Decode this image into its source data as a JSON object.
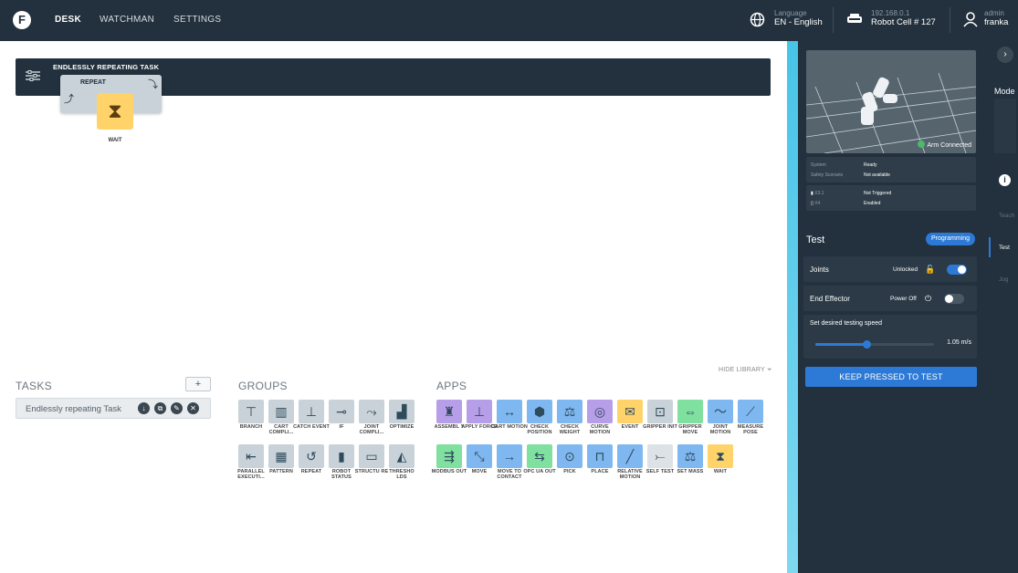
{
  "topbar": {
    "nav": [
      "DESK",
      "WATCHMAN",
      "SETTINGS"
    ],
    "language_label": "Language",
    "language_value": "EN - English",
    "ip": "192.168.0.1",
    "robot_name": "Robot Cell # 127",
    "user_role": "admin",
    "user_name": "franka"
  },
  "task": {
    "title": "ENDLESSLY REPEATING TASK",
    "repeat_label": "REPEAT",
    "wait_label": "WAIT"
  },
  "library": {
    "hide_label": "HIDE LIBRARY",
    "tasks_header": "TASKS",
    "add_label": "+",
    "task_name": "Endlessly repeating Task",
    "groups_header": "GROUPS",
    "apps_header": "APPS",
    "groups": [
      "BRANCH",
      "CART COMPLI...",
      "CATCH EVENT",
      "IF",
      "JOINT COMPLI...",
      "OPTIMIZE",
      "PARALLEL EXECUTI...",
      "PATTERN",
      "REPEAT",
      "ROBOT STATUS",
      "STRUCTU RE",
      "THRESHO LDS"
    ],
    "apps": [
      "ASSEMBL Y",
      "APPLY FORCE",
      "CART MOTION",
      "CHECK POSITION",
      "CHECK WEIGHT",
      "CURVE MOTION",
      "EVENT",
      "GRIPPER INIT",
      "GRIPPER MOVE",
      "JOINT MOTION",
      "MEASURE POSE",
      "MODBUS OUT",
      "MOVE",
      "MOVE TO CONTACT",
      "OPC UA OUT",
      "PICK",
      "PLACE",
      "RELATIVE MOTION",
      "SELF TEST",
      "SET MASS",
      "WAIT"
    ]
  },
  "panel": {
    "arm_status": "Arm Connected",
    "status_rows": [
      {
        "key": "System",
        "value": "Ready"
      },
      {
        "key": "Safety Scenario",
        "value": "Not available"
      }
    ],
    "io_rows": [
      {
        "key": "X3.1",
        "value": "Not Triggered"
      },
      {
        "key": "X4",
        "value": "Enabled"
      }
    ],
    "mode_title": "Test",
    "mode_badge": "Programming",
    "joints_label": "Joints",
    "joints_state": "Unlocked",
    "ee_label": "End Effector",
    "ee_state": "Power Off",
    "speed_label": "Set desired testing speed",
    "speed_value": "1.05 m/s",
    "speed_fraction": 0.43,
    "keep_button": "KEEP PRESSED TO TEST"
  },
  "sidebar": {
    "mode_label": "Mode",
    "items": [
      "Teach",
      "Test",
      "Jog"
    ]
  },
  "icons": {
    "globe": "globe-icon",
    "robot": "robot-cell-icon",
    "user": "user-icon",
    "filter": "filter-icon"
  },
  "colors": {
    "dark": "#22313d",
    "accent_blue": "#2d7ad6",
    "wait_yellow": "#ffd36a",
    "connected_green": "#4cba6a",
    "cyan_stripe": "#47c4e8"
  }
}
